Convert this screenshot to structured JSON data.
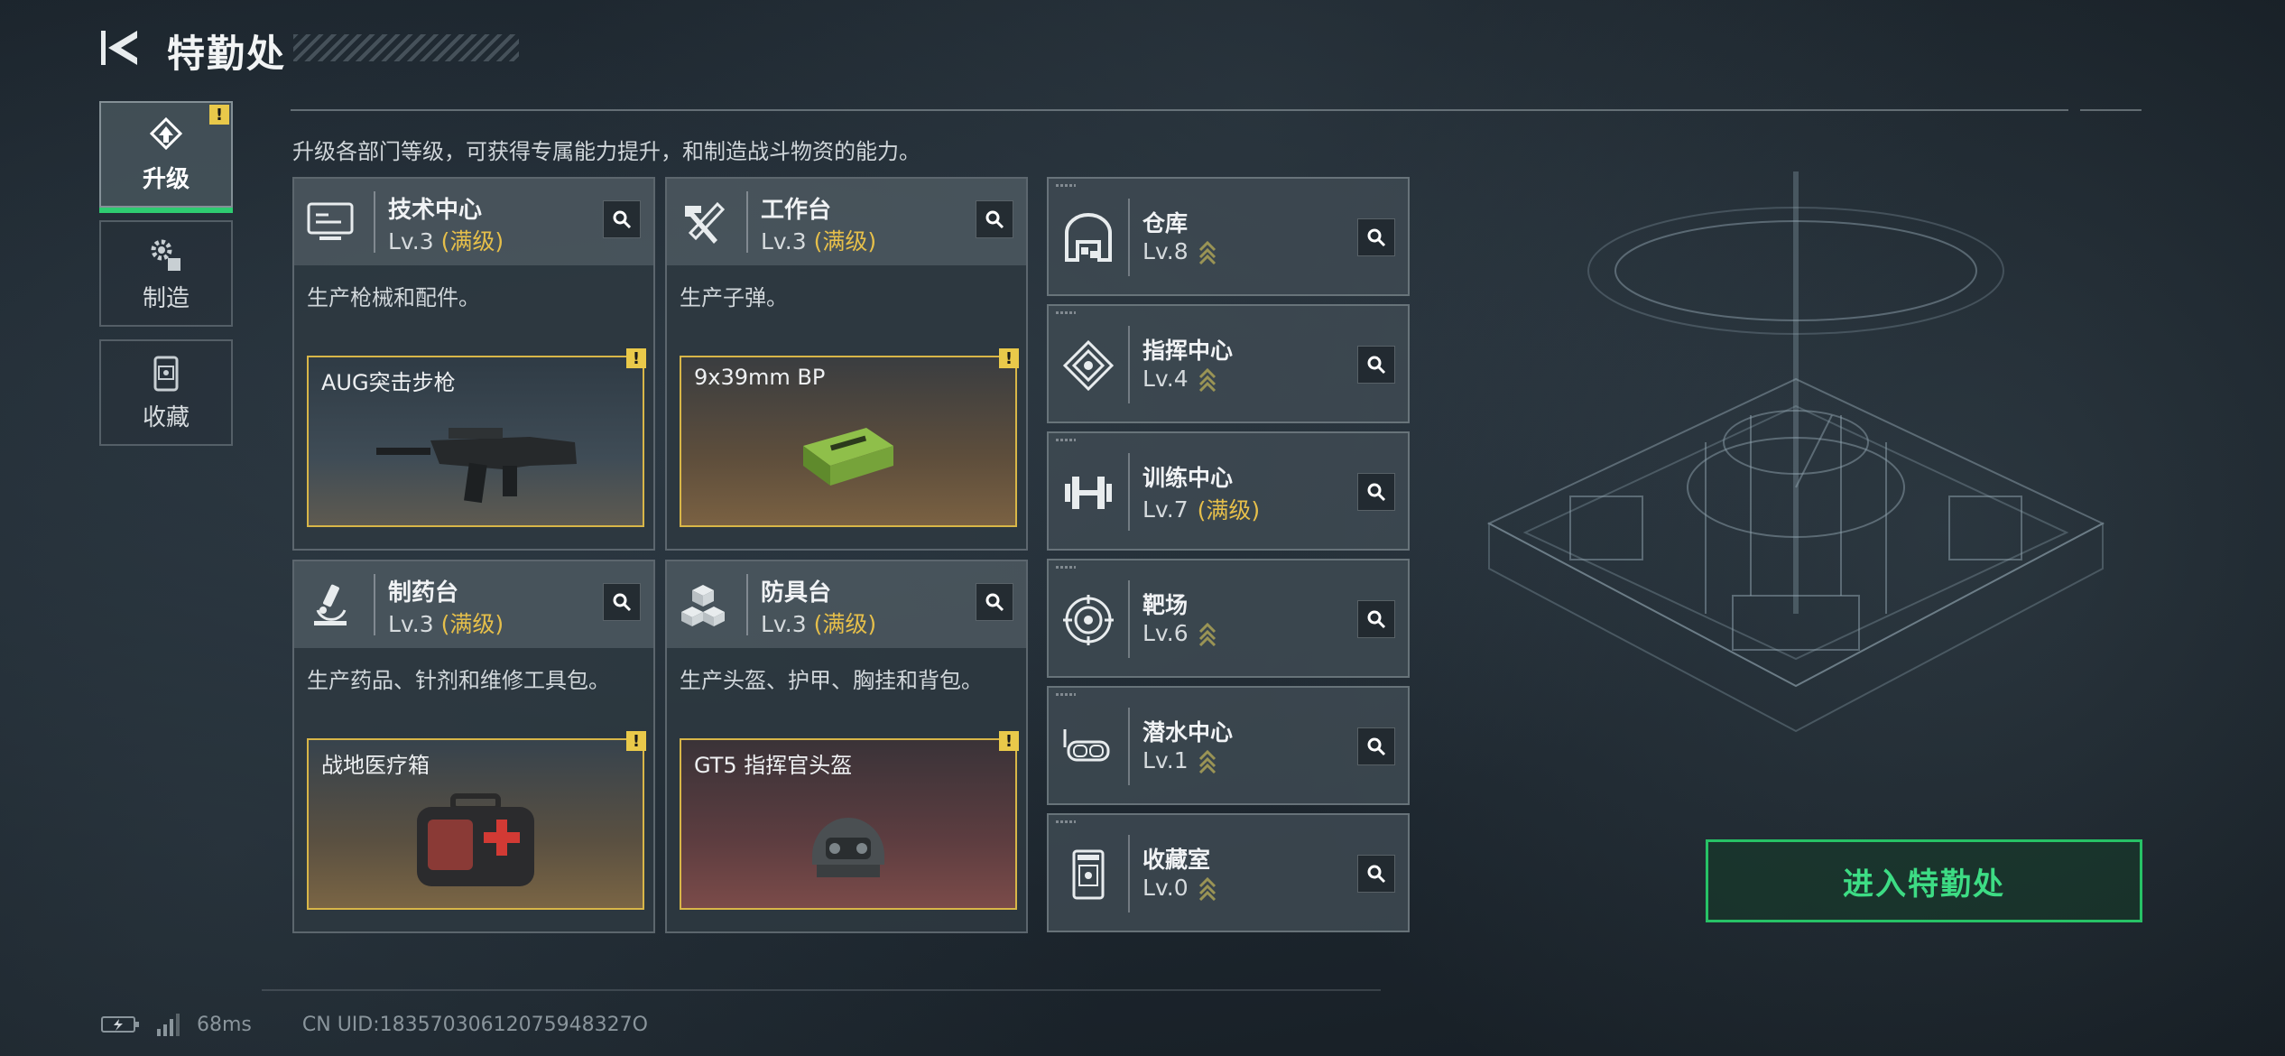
{
  "header": {
    "title": "特勤处",
    "intro": "升级各部门等级，可获得专属能力提升，和制造战斗物资的能力。"
  },
  "tabs": [
    {
      "label": "升级",
      "icon": "upgrade-icon",
      "active": true,
      "badge": "!"
    },
    {
      "label": "制造",
      "icon": "gears-icon",
      "active": false
    },
    {
      "label": "收藏",
      "icon": "collection-icon",
      "active": false
    }
  ],
  "cards": [
    {
      "name": "技术中心",
      "level": "Lv.3",
      "tag": "(满级)",
      "desc": "生产枪械和配件。",
      "item": "AUG突击步枪",
      "badge": "!",
      "icon": "monitor-icon"
    },
    {
      "name": "工作台",
      "level": "Lv.3",
      "tag": "(满级)",
      "desc": "生产子弹。",
      "item": "9x39mm BP",
      "badge": "!",
      "icon": "tools-icon"
    },
    {
      "name": "制药台",
      "level": "Lv.3",
      "tag": "(满级)",
      "desc": "生产药品、针剂和维修工具包。",
      "item": "战地医疗箱",
      "badge": "!",
      "icon": "microscope-icon"
    },
    {
      "name": "防具台",
      "level": "Lv.3",
      "tag": "(满级)",
      "desc": "生产头盔、护甲、胸挂和背包。",
      "item": "GT5 指挥官头盔",
      "badge": "!",
      "icon": "cubes-icon"
    }
  ],
  "facilities": [
    {
      "name": "仓库",
      "level": "Lv.8",
      "tag": "",
      "upgradable": true,
      "icon": "warehouse-icon"
    },
    {
      "name": "指挥中心",
      "level": "Lv.4",
      "tag": "",
      "upgradable": true,
      "icon": "command-icon"
    },
    {
      "name": "训练中心",
      "level": "Lv.7",
      "tag": "(满级)",
      "upgradable": false,
      "icon": "dumbbell-icon"
    },
    {
      "name": "靶场",
      "level": "Lv.6",
      "tag": "",
      "upgradable": true,
      "icon": "target-icon"
    },
    {
      "name": "潜水中心",
      "level": "Lv.1",
      "tag": "",
      "upgradable": true,
      "icon": "goggles-icon"
    },
    {
      "name": "收藏室",
      "level": "Lv.0",
      "tag": "",
      "upgradable": true,
      "icon": "collection-room-icon"
    }
  ],
  "enter_button": "进入特勤处",
  "footer": {
    "ping": "68ms",
    "uid": "CN UID:18357030612075948327O"
  },
  "colors": {
    "accent_green": "#27c266",
    "max_level": "#e6bf4a",
    "badge": "#e9c94a"
  }
}
